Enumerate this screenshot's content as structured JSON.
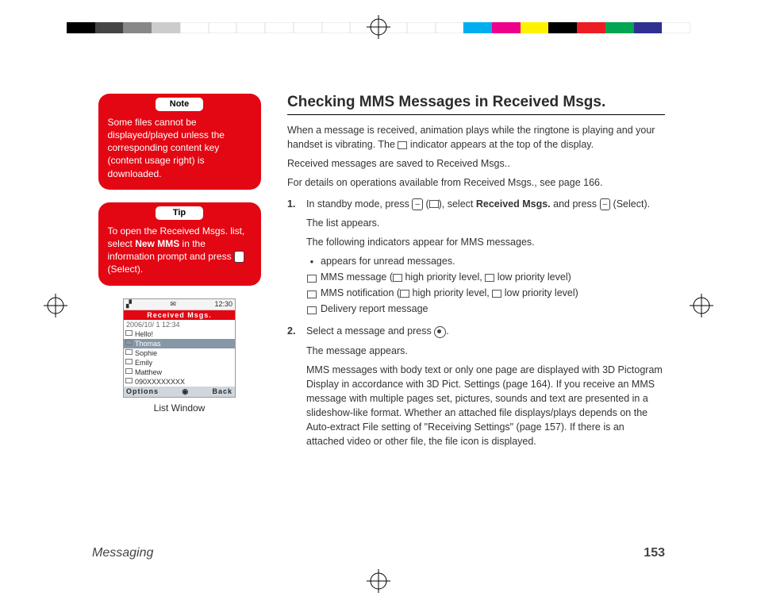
{
  "colorbar": [
    "#000",
    "#444",
    "#888",
    "#ccc",
    "#fff",
    "#fff",
    "#fff",
    "#fff",
    "#fff",
    "#fff",
    "#fff",
    "#fff",
    "#fff",
    "#fff",
    "#00aeef",
    "#ec008c",
    "#fff200",
    "#000",
    "#ed1c24",
    "#00a651",
    "#2e3192",
    "#fff"
  ],
  "footer": {
    "section": "Messaging",
    "page": "153"
  },
  "note": {
    "header": "Note",
    "body": "Some files cannot be displayed/played unless the corresponding content key (content usage right) is downloaded."
  },
  "tip": {
    "header": "Tip",
    "body_pre": "To open the Received Msgs. list, select ",
    "body_bold": "New MMS",
    "body_post": " in the information prompt and press ",
    "body_tail": " (Select)."
  },
  "phone": {
    "time": "12:30",
    "title": "Received Msgs.",
    "meta": "2006/10/ 1 12:34",
    "rows": [
      "Hello!",
      "Thomas",
      "Sophie",
      "Emily",
      "Matthew",
      "090XXXXXXXX"
    ],
    "selected_index": 1,
    "soft_left": "Options",
    "soft_right": "Back",
    "caption": "List Window"
  },
  "main": {
    "title": "Checking MMS Messages in Received Msgs.",
    "p1a": "When a message is received, animation plays while the ringtone is playing and your handset is vibrating. The ",
    "p1b": " indicator appears at the top of the display.",
    "p2": "Received messages are saved to Received Msgs..",
    "p3": "For details on operations available from Received Msgs., see page 166.",
    "steps": [
      {
        "num": "1.",
        "l1a": "In standby mode, press ",
        "l1b": " (",
        "l1c": "), select ",
        "l1_bold": "Received Msgs.",
        "l1d": " and press ",
        "l1e": " (Select).",
        "after1": "The list appears.",
        "after2": "The following indicators appear for MMS messages.",
        "ind": [
          {
            "icon": "dot",
            "text": "appears for unread messages."
          },
          {
            "icon": "env",
            "text_pre": "MMS message (",
            "hp": " high priority level, ",
            "lp": " low priority level)"
          },
          {
            "icon": "envn",
            "text_pre": "MMS notification (",
            "hp": " high priority level, ",
            "lp": " low priority level)"
          },
          {
            "icon": "page",
            "text": "Delivery report message"
          }
        ]
      },
      {
        "num": "2.",
        "l1a": "Select a message and press ",
        "l1b": ".",
        "after1": "The message appears.",
        "body": "MMS messages with body text or only one page are displayed with 3D Pictogram Display in accordance with 3D Pict. Settings (page 164). If you receive an MMS message with multiple pages set, pictures, sounds and text are presented in a slideshow-like format. Whether an attached file displays/plays depends on the Auto-extract File setting of \"Receiving Settings\" (page 157). If there is an attached video or other file, the file icon is displayed."
      }
    ]
  }
}
